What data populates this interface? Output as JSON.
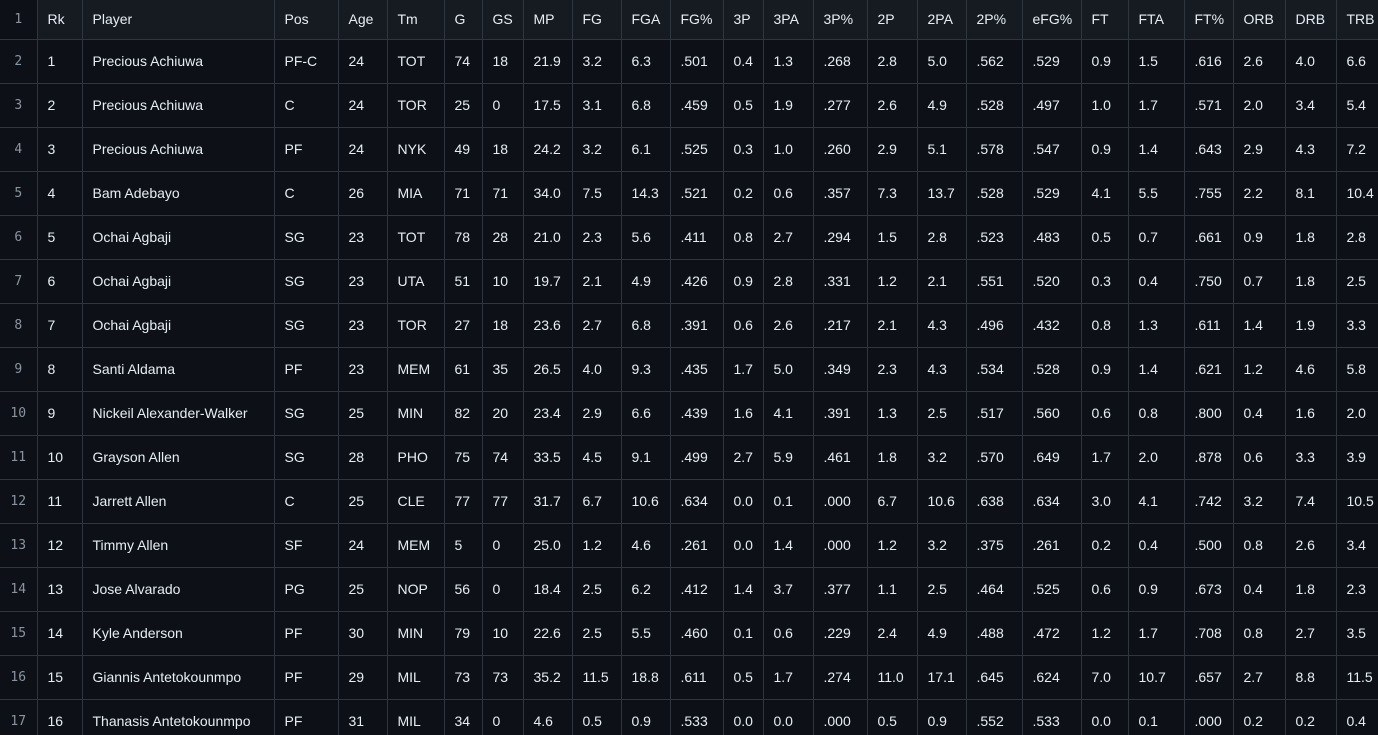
{
  "table": {
    "columns": [
      "Rk",
      "Player",
      "Pos",
      "Age",
      "Tm",
      "G",
      "GS",
      "MP",
      "FG",
      "FGA",
      "FG%",
      "3P",
      "3PA",
      "3P%",
      "2P",
      "2PA",
      "2P%",
      "eFG%",
      "FT",
      "FTA",
      "FT%",
      "ORB",
      "DRB",
      "TRB"
    ],
    "row_numbers": [
      "1",
      "2",
      "3",
      "4",
      "5",
      "6",
      "7",
      "8",
      "9",
      "10",
      "11",
      "12",
      "13",
      "14",
      "15",
      "16",
      "17"
    ],
    "rows": [
      [
        "1",
        "Precious Achiuwa",
        "PF-C",
        "24",
        "TOT",
        "74",
        "18",
        "21.9",
        "3.2",
        "6.3",
        ".501",
        "0.4",
        "1.3",
        ".268",
        "2.8",
        "5.0",
        ".562",
        ".529",
        "0.9",
        "1.5",
        ".616",
        "2.6",
        "4.0",
        "6.6"
      ],
      [
        "2",
        "Precious Achiuwa",
        "C",
        "24",
        "TOR",
        "25",
        "0",
        "17.5",
        "3.1",
        "6.8",
        ".459",
        "0.5",
        "1.9",
        ".277",
        "2.6",
        "4.9",
        ".528",
        ".497",
        "1.0",
        "1.7",
        ".571",
        "2.0",
        "3.4",
        "5.4"
      ],
      [
        "3",
        "Precious Achiuwa",
        "PF",
        "24",
        "NYK",
        "49",
        "18",
        "24.2",
        "3.2",
        "6.1",
        ".525",
        "0.3",
        "1.0",
        ".260",
        "2.9",
        "5.1",
        ".578",
        ".547",
        "0.9",
        "1.4",
        ".643",
        "2.9",
        "4.3",
        "7.2"
      ],
      [
        "4",
        "Bam Adebayo",
        "C",
        "26",
        "MIA",
        "71",
        "71",
        "34.0",
        "7.5",
        "14.3",
        ".521",
        "0.2",
        "0.6",
        ".357",
        "7.3",
        "13.7",
        ".528",
        ".529",
        "4.1",
        "5.5",
        ".755",
        "2.2",
        "8.1",
        "10.4"
      ],
      [
        "5",
        "Ochai Agbaji",
        "SG",
        "23",
        "TOT",
        "78",
        "28",
        "21.0",
        "2.3",
        "5.6",
        ".411",
        "0.8",
        "2.7",
        ".294",
        "1.5",
        "2.8",
        ".523",
        ".483",
        "0.5",
        "0.7",
        ".661",
        "0.9",
        "1.8",
        "2.8"
      ],
      [
        "6",
        "Ochai Agbaji",
        "SG",
        "23",
        "UTA",
        "51",
        "10",
        "19.7",
        "2.1",
        "4.9",
        ".426",
        "0.9",
        "2.8",
        ".331",
        "1.2",
        "2.1",
        ".551",
        ".520",
        "0.3",
        "0.4",
        ".750",
        "0.7",
        "1.8",
        "2.5"
      ],
      [
        "7",
        "Ochai Agbaji",
        "SG",
        "23",
        "TOR",
        "27",
        "18",
        "23.6",
        "2.7",
        "6.8",
        ".391",
        "0.6",
        "2.6",
        ".217",
        "2.1",
        "4.3",
        ".496",
        ".432",
        "0.8",
        "1.3",
        ".611",
        "1.4",
        "1.9",
        "3.3"
      ],
      [
        "8",
        "Santi Aldama",
        "PF",
        "23",
        "MEM",
        "61",
        "35",
        "26.5",
        "4.0",
        "9.3",
        ".435",
        "1.7",
        "5.0",
        ".349",
        "2.3",
        "4.3",
        ".534",
        ".528",
        "0.9",
        "1.4",
        ".621",
        "1.2",
        "4.6",
        "5.8"
      ],
      [
        "9",
        "Nickeil Alexander-Walker",
        "SG",
        "25",
        "MIN",
        "82",
        "20",
        "23.4",
        "2.9",
        "6.6",
        ".439",
        "1.6",
        "4.1",
        ".391",
        "1.3",
        "2.5",
        ".517",
        ".560",
        "0.6",
        "0.8",
        ".800",
        "0.4",
        "1.6",
        "2.0"
      ],
      [
        "10",
        "Grayson Allen",
        "SG",
        "28",
        "PHO",
        "75",
        "74",
        "33.5",
        "4.5",
        "9.1",
        ".499",
        "2.7",
        "5.9",
        ".461",
        "1.8",
        "3.2",
        ".570",
        ".649",
        "1.7",
        "2.0",
        ".878",
        "0.6",
        "3.3",
        "3.9"
      ],
      [
        "11",
        "Jarrett Allen",
        "C",
        "25",
        "CLE",
        "77",
        "77",
        "31.7",
        "6.7",
        "10.6",
        ".634",
        "0.0",
        "0.1",
        ".000",
        "6.7",
        "10.6",
        ".638",
        ".634",
        "3.0",
        "4.1",
        ".742",
        "3.2",
        "7.4",
        "10.5"
      ],
      [
        "12",
        "Timmy Allen",
        "SF",
        "24",
        "MEM",
        "5",
        "0",
        "25.0",
        "1.2",
        "4.6",
        ".261",
        "0.0",
        "1.4",
        ".000",
        "1.2",
        "3.2",
        ".375",
        ".261",
        "0.2",
        "0.4",
        ".500",
        "0.8",
        "2.6",
        "3.4"
      ],
      [
        "13",
        "Jose Alvarado",
        "PG",
        "25",
        "NOP",
        "56",
        "0",
        "18.4",
        "2.5",
        "6.2",
        ".412",
        "1.4",
        "3.7",
        ".377",
        "1.1",
        "2.5",
        ".464",
        ".525",
        "0.6",
        "0.9",
        ".673",
        "0.4",
        "1.8",
        "2.3"
      ],
      [
        "14",
        "Kyle Anderson",
        "PF",
        "30",
        "MIN",
        "79",
        "10",
        "22.6",
        "2.5",
        "5.5",
        ".460",
        "0.1",
        "0.6",
        ".229",
        "2.4",
        "4.9",
        ".488",
        ".472",
        "1.2",
        "1.7",
        ".708",
        "0.8",
        "2.7",
        "3.5"
      ],
      [
        "15",
        "Giannis Antetokounmpo",
        "PF",
        "29",
        "MIL",
        "73",
        "73",
        "35.2",
        "11.5",
        "18.8",
        ".611",
        "0.5",
        "1.7",
        ".274",
        "11.0",
        "17.1",
        ".645",
        ".624",
        "7.0",
        "10.7",
        ".657",
        "2.7",
        "8.8",
        "11.5"
      ],
      [
        "16",
        "Thanasis Antetokounmpo",
        "PF",
        "31",
        "MIL",
        "34",
        "0",
        "4.6",
        "0.5",
        "0.9",
        ".533",
        "0.0",
        "0.0",
        ".000",
        "0.5",
        "0.9",
        ".552",
        ".533",
        "0.0",
        "0.1",
        ".000",
        "0.2",
        "0.2",
        "0.4"
      ]
    ]
  }
}
